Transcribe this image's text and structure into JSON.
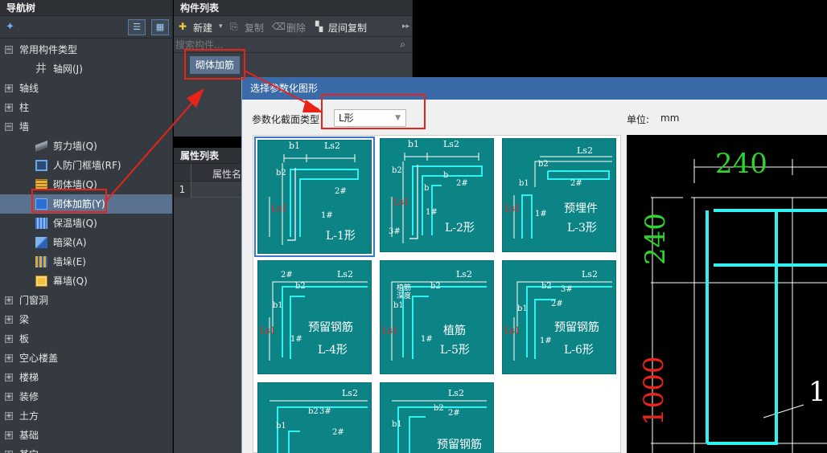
{
  "nav": {
    "title": "导航树",
    "items": [
      {
        "label": "常用构件类型",
        "expander": "−"
      },
      {
        "label": "轴网(J)"
      },
      {
        "label": "轴线",
        "expander": "+"
      },
      {
        "label": "柱",
        "expander": "+"
      },
      {
        "label": "墙",
        "expander": "−"
      },
      {
        "label": "剪力墙(Q)"
      },
      {
        "label": "人防门框墙(RF)"
      },
      {
        "label": "砌体墙(Q)"
      },
      {
        "label": "砌体加筋(Y)"
      },
      {
        "label": "保温墙(Q)"
      },
      {
        "label": "暗梁(A)"
      },
      {
        "label": "墙垛(E)"
      },
      {
        "label": "幕墙(Q)"
      },
      {
        "label": "门窗洞",
        "expander": "+"
      },
      {
        "label": "梁",
        "expander": "+"
      },
      {
        "label": "板",
        "expander": "+"
      },
      {
        "label": "空心楼盖",
        "expander": "+"
      },
      {
        "label": "楼梯",
        "expander": "+"
      },
      {
        "label": "装修",
        "expander": "+"
      },
      {
        "label": "土方",
        "expander": "+"
      },
      {
        "label": "基础",
        "expander": "+"
      },
      {
        "label": "其它",
        "expander": "+"
      }
    ]
  },
  "component": {
    "title": "构件列表",
    "new_label": "新建",
    "copy_label": "复制",
    "delete_label": "删除",
    "floor_copy_label": "层间复制",
    "search_placeholder": "搜索构件...",
    "item": "砌体加筋"
  },
  "property": {
    "title": "属性列表",
    "col_name": "属性名",
    "row1": "1"
  },
  "dialog": {
    "title": "选择参数化图形",
    "section_type_label": "参数化截面类型",
    "section_type_value": "L形",
    "unit_label": "单位:",
    "unit_value": "mm",
    "shapes": [
      {
        "label": "L-1形"
      },
      {
        "label": "L-2形"
      },
      {
        "label": "预埋件",
        "label2": "L-3形"
      },
      {
        "label": "预留钢筋",
        "label2": "L-4形"
      },
      {
        "label": "植筋",
        "label2": "L-5形"
      },
      {
        "label": "预留钢筋",
        "label2": "L-6形"
      },
      {
        "label": ""
      },
      {
        "label": "预留钢筋"
      }
    ],
    "thumb_text": {
      "b1": "b1",
      "b2": "b2",
      "ls2": "Ls2",
      "ls1": "Ls1",
      "r1": "1#",
      "r2": "2#",
      "r3": "3#",
      "b": "b",
      "depth1": "植筋",
      "depth2": "深度"
    }
  },
  "preview": {
    "dim_top": "240",
    "dim_left_top": "240",
    "dim_left_bottom": "1000",
    "label": "1"
  },
  "colors": {
    "accent": "#3b6aa8",
    "thumb_bg": "#0c8486",
    "annotation": "#e8231a",
    "dim_green": "#2ed32e",
    "dim_red": "#e8231a",
    "rebar_cyan": "#2ef2f2"
  }
}
